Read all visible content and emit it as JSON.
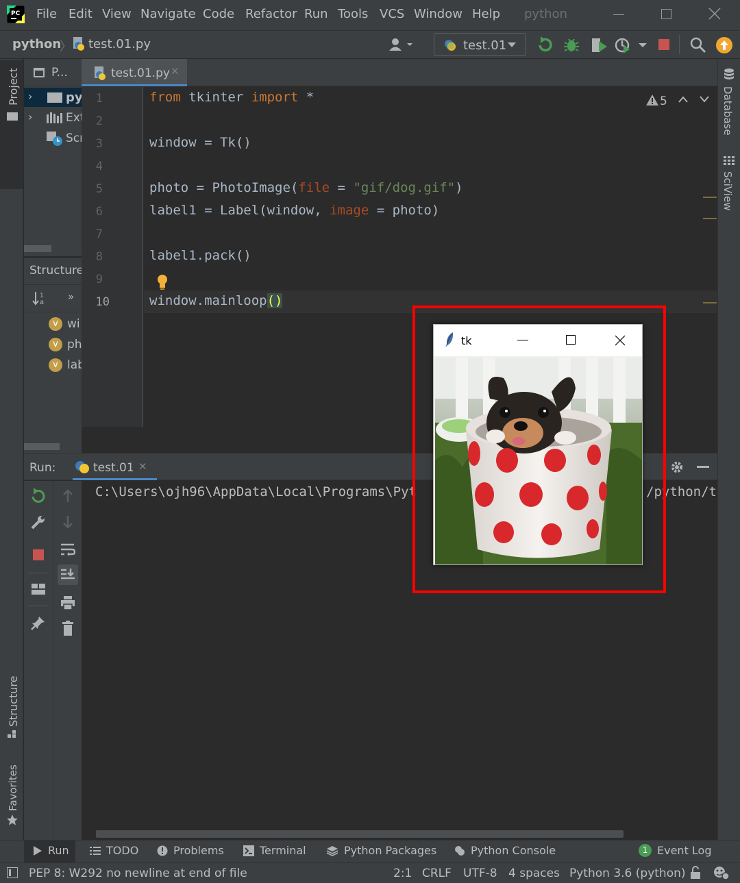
{
  "menubar": {
    "items": [
      "File",
      "Edit",
      "View",
      "Navigate",
      "Code",
      "Refactor",
      "Run",
      "Tools",
      "VCS",
      "Window",
      "Help"
    ],
    "project_title": "python"
  },
  "navbar": {
    "breadcrumb_project": "python",
    "breadcrumb_file": "test.01.py",
    "run_config": "test.01"
  },
  "left_stripe": {
    "project_label": "Project",
    "structure_label": "Structure",
    "favorites_label": "Favorites"
  },
  "right_stripe": {
    "database_label": "Database",
    "sciview_label": "SciView"
  },
  "project_panel": {
    "header": "P...",
    "items": [
      "py",
      "Ext",
      "Scr"
    ]
  },
  "structure_panel": {
    "title": "Structure",
    "items": [
      "wi",
      "ph",
      "lab"
    ],
    "item_badge": "v"
  },
  "editor": {
    "tab_label": "test.01.py",
    "warnings_count": "5",
    "lines": [
      "1",
      "2",
      "3",
      "4",
      "5",
      "6",
      "7",
      "8",
      "9",
      "10"
    ]
  },
  "run_panel": {
    "label": "Run:",
    "tab": "test.01",
    "output_left": "C:\\Users\\ojh96\\AppData\\Local\\Programs\\Pyt",
    "output_right": "/python/t"
  },
  "tk_window": {
    "title": "tk"
  },
  "bottom_tabs": [
    "Run",
    "TODO",
    "Problems",
    "Terminal",
    "Python Packages",
    "Python Console"
  ],
  "event_log": {
    "badge": "1",
    "label": "Event Log"
  },
  "statusbar": {
    "message": "PEP 8: W292 no newline at end of file",
    "position": "2:1",
    "line_ending": "CRLF",
    "encoding": "UTF-8",
    "indent": "4 spaces",
    "interpreter": "Python 3.6 (python)"
  },
  "colors": {
    "highlight_box": "#ff0000",
    "keyword": "#cc7832",
    "string": "#6a8759",
    "param": "#aa4926"
  }
}
